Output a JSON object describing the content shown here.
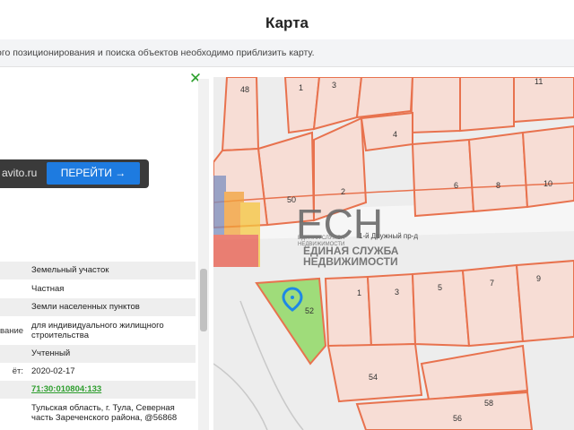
{
  "page": {
    "title": "Карта"
  },
  "notice": {
    "text": "ого позиционирования и поиска объектов необходимо приблизить карту."
  },
  "ad": {
    "domain": "avito.ru",
    "button_label": "ПЕРЕЙТИ →"
  },
  "properties": [
    {
      "label": "",
      "value": "Земельный участок"
    },
    {
      "label": "",
      "value": "Частная"
    },
    {
      "label": "",
      "value": "Земли населенных пунктов"
    },
    {
      "label": "вание",
      "value": "для индивидуального жилищного строительства"
    },
    {
      "label": "",
      "value": "Учтенный"
    },
    {
      "label": "ёт:",
      "value": "2020-02-17"
    },
    {
      "label": "",
      "value": "71:30:010804:133"
    },
    {
      "label": "",
      "value": "Тульская область, г. Тула, Северная часть Зареченского района, @56868"
    }
  ],
  "map": {
    "street_label": "1-й Дружный пр-д",
    "watermark": {
      "short": "ЕСН",
      "line1": "ЕДИНАЯ СЛУЖБА",
      "line2": "НЕДВИЖИМОСТИ",
      "tiny1": "ЕДИНАЯ СЛУЖБА",
      "tiny2": "НЕДВИЖИМОСТИ"
    },
    "parcel_numbers": [
      "48",
      "1",
      "3",
      "11",
      "4",
      "2",
      "6",
      "8",
      "10",
      "50",
      "1",
      "3",
      "5",
      "7",
      "9",
      "52",
      "54",
      "58",
      "56"
    ],
    "colors": {
      "boundary": "#e8724e",
      "parcel_fill": "#f7ddd5",
      "selected_fill": "#9fdc7a",
      "marker": "#1e88e5"
    }
  }
}
